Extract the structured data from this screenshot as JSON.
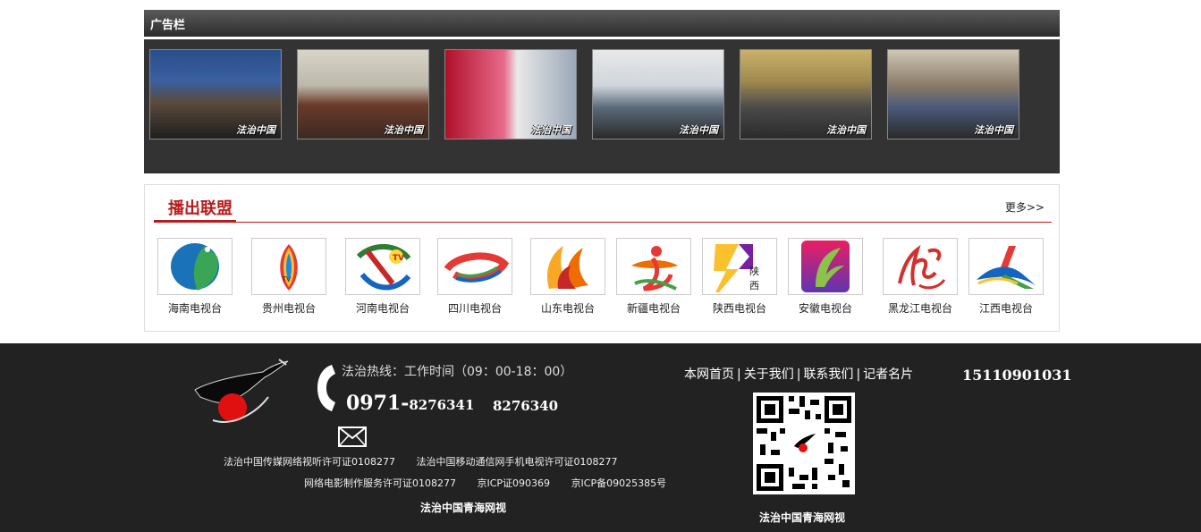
{
  "ad_bar": {
    "title": "广告栏",
    "thumbnails": [
      {
        "watermark": "法治中国"
      },
      {
        "watermark": "法治中国"
      },
      {
        "watermark": "法治中国"
      },
      {
        "watermark": "法治中国"
      },
      {
        "watermark": "法治中国"
      },
      {
        "watermark": "法治中国"
      }
    ]
  },
  "alliance": {
    "title": "播出联盟",
    "more": "更多>>",
    "stations": [
      {
        "name": "海南电视台"
      },
      {
        "name": "贵州电视台"
      },
      {
        "name": "河南电视台"
      },
      {
        "name": "四川电视台"
      },
      {
        "name": "山东电视台"
      },
      {
        "name": "新疆电视台"
      },
      {
        "name": "陕西电视台"
      },
      {
        "name": "安徽电视台"
      },
      {
        "name": "黑龙江电视台"
      },
      {
        "name": "江西电视台"
      }
    ]
  },
  "footer": {
    "hotline_label": "法治热线：工作时间（09：00-18：00）",
    "phone_prefix": "0971-",
    "phone_main": "8276341",
    "phone_second": "8276340",
    "licenses_row1": [
      "法治中国传媒网络视听许可证0108277",
      "法治中国移动通信网手机电视许可证0108277"
    ],
    "licenses_row2": [
      "网络电影制作服务许可证0108277",
      "京ICP证090369",
      "京ICP备09025385号"
    ],
    "site_name_left": "法治中国青海网视",
    "nav": [
      "本网首页",
      "关于我们",
      "联系我们",
      "记者名片"
    ],
    "mobile": "15110901031",
    "site_name_right": "法治中国青海网视"
  },
  "colors": {
    "accent_red": "#b71c1c",
    "footer_bg": "#222222",
    "ad_bg": "#333333"
  }
}
